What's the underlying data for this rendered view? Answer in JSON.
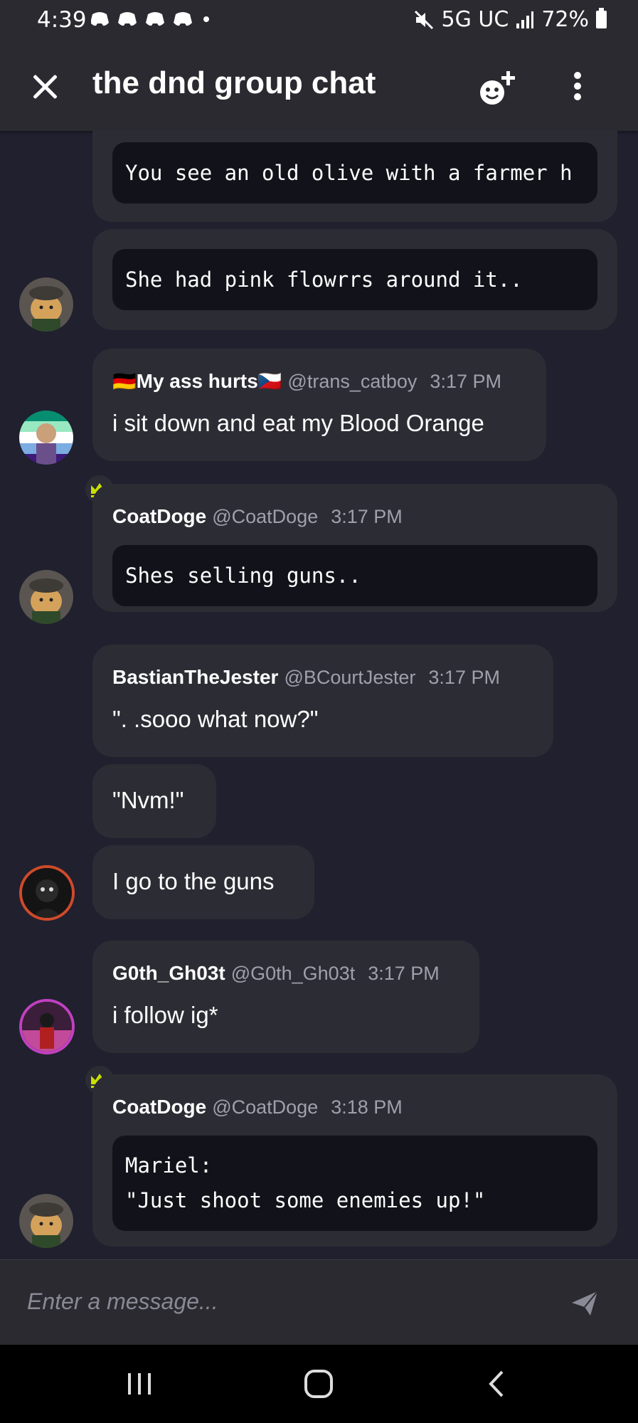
{
  "status_bar": {
    "time": "4:39",
    "network": "5G UC",
    "battery": "72%"
  },
  "header": {
    "title": "the dnd group chat"
  },
  "messages": [
    {
      "type": "code",
      "text": "You see an old olive with a farmer h"
    },
    {
      "type": "code",
      "text": "She had pink flowrrs around it.."
    },
    {
      "type": "user",
      "flag_left": "🇩🇪",
      "author": "My ass hurts",
      "flag_right": "🇨🇿",
      "handle": "@trans_catboy",
      "time": "3:17 PM",
      "text": "i sit down and eat my Blood Orange"
    },
    {
      "type": "code-header",
      "author": "CoatDoge",
      "handle": "@CoatDoge",
      "time": "3:17 PM",
      "text": "Shes selling guns.."
    },
    {
      "type": "user",
      "author": "BastianTheJester",
      "handle": "@BCourtJester",
      "time": "3:17 PM",
      "text": "\". .sooo what now?\""
    },
    {
      "type": "plain",
      "text": "\"Nvm!\""
    },
    {
      "type": "plain",
      "text": "I go to the guns"
    },
    {
      "type": "user",
      "author": "G0th_Gh03t",
      "handle": "@G0th_Gh03t",
      "time": "3:17 PM",
      "text": "i follow ig*"
    },
    {
      "type": "code-header",
      "author": "CoatDoge",
      "handle": "@CoatDoge",
      "time": "3:18 PM",
      "text": "Mariel:\n\"Just shoot some enemies up!\""
    }
  ],
  "input": {
    "placeholder": "Enter a message..."
  },
  "colors": {
    "background": "#20202e",
    "bubble": "#2c2c34",
    "code": "#12121a",
    "crown": "#c8e000"
  }
}
